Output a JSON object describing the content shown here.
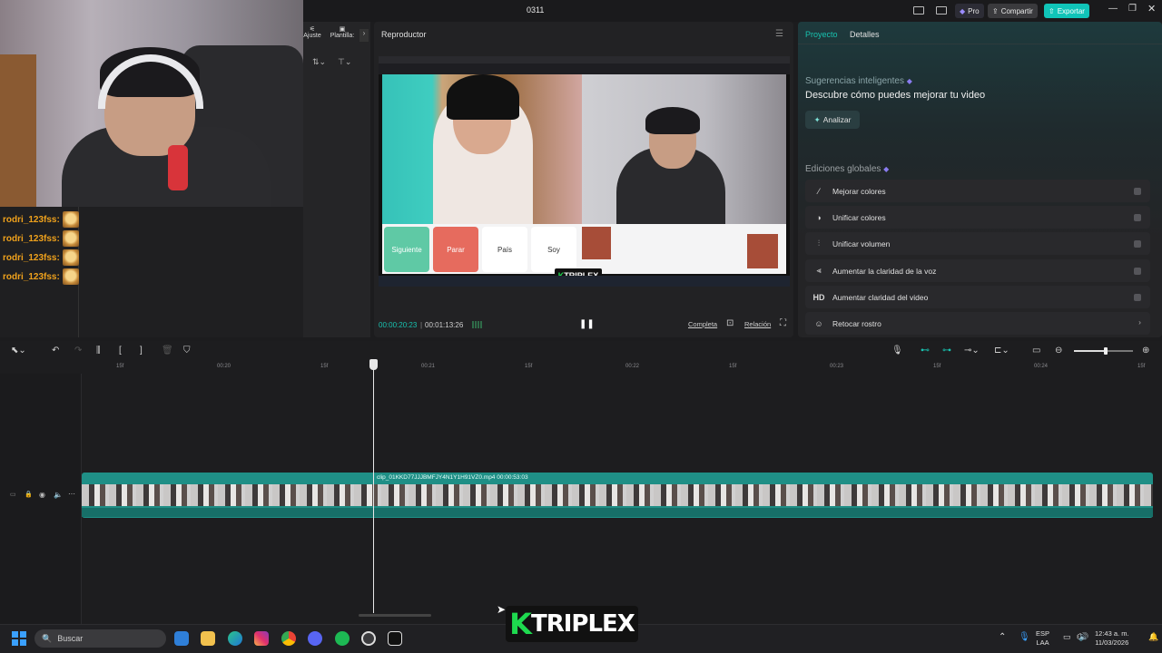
{
  "window": {
    "title": "0311"
  },
  "header": {
    "pro_label": "Pro",
    "share_label": "Compartir",
    "export_label": "Exportar"
  },
  "left_tools": {
    "ajuste_label": "Ajuste",
    "plantillas_label": "Plantilla:"
  },
  "chat": {
    "messages": [
      {
        "user": "rodri_123fss:"
      },
      {
        "user": "rodri_123fss:"
      },
      {
        "user": "rodri_123fss:"
      },
      {
        "user": "rodri_123fss:"
      }
    ]
  },
  "player": {
    "title": "Reproductor",
    "current_time": "00:00:20:23",
    "total_time": "00:01:13:26",
    "complete_label": "Completa",
    "ratio_label": "Relación",
    "video_buttons": {
      "next": "Siguiente",
      "stop": "Parar",
      "country": "País",
      "soy": "Soy"
    },
    "overlay_logo": "TRIPLEX"
  },
  "right_panel": {
    "tab_project": "Proyecto",
    "tab_details": "Detalles",
    "suggest_title": "Sugerencias inteligentes",
    "suggest_desc": "Descubre cómo puedes mejorar tu video",
    "analyze_label": "Analizar",
    "global_title": "Ediciones globales",
    "edits": [
      {
        "icon": "wand-icon",
        "label": "Mejorar colores"
      },
      {
        "icon": "palette-icon",
        "label": "Unificar colores"
      },
      {
        "icon": "sliders-icon",
        "label": "Unificar volumen"
      },
      {
        "icon": "voice-icon",
        "label": "Aumentar la claridad de la voz"
      },
      {
        "icon": "hd-icon",
        "glyph": "HD",
        "label": "Aumentar claridad del video"
      },
      {
        "icon": "face-icon",
        "label": "Retocar rostro"
      }
    ]
  },
  "timeline": {
    "ticks": [
      "15f",
      "00:20",
      "15f",
      "00:21",
      "15f",
      "00:22",
      "15f",
      "00:23",
      "15f",
      "00:24",
      "15f"
    ],
    "clip_label": "clip_01KKD77JJJBMFJY4N1Y1H91VZ0.mp4   00:00:53:03"
  },
  "taskbar": {
    "search_placeholder": "Buscar",
    "lang_top": "ESP",
    "lang_bottom": "LAA",
    "time": "12:43 a. m.",
    "date": "11/03/2026"
  },
  "watermark": {
    "text": "TRIPLEX",
    "k": "K"
  },
  "colors": {
    "accent": "#18c3b0",
    "export": "#10c4b8",
    "chat_name": "#f0a21c"
  }
}
